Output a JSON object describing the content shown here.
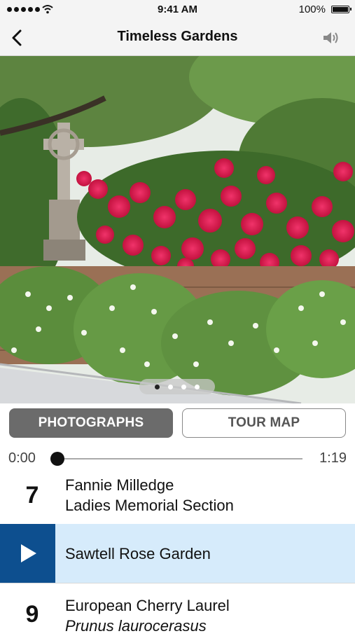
{
  "status_bar": {
    "time": "9:41 AM",
    "battery": "100%"
  },
  "nav": {
    "title": "Timeless Gardens",
    "back_icon": "chevron-left-icon",
    "audio_icon": "speaker-icon"
  },
  "carousel": {
    "pages": 4,
    "active_page": 1
  },
  "tabs": {
    "photographs": "PHOTOGRAPHS",
    "tour_map": "TOUR MAP",
    "selected": "PHOTOGRAPHS"
  },
  "player": {
    "elapsed": "0:00",
    "duration": "1:19",
    "progress": 0
  },
  "stops": [
    {
      "number": "7",
      "line1": "Fannie Milledge",
      "line2": "Ladies Memorial Section"
    },
    {
      "line1": "Sawtell Rose Garden",
      "playing": true
    },
    {
      "number": "9",
      "line1": "European Cherry Laurel",
      "line2": "Prunus laurocerasus"
    }
  ],
  "colors": {
    "selected_row": "#d6ebfb",
    "play_box": "#0d4f8f",
    "tab_selected": "#6b6b6b"
  }
}
